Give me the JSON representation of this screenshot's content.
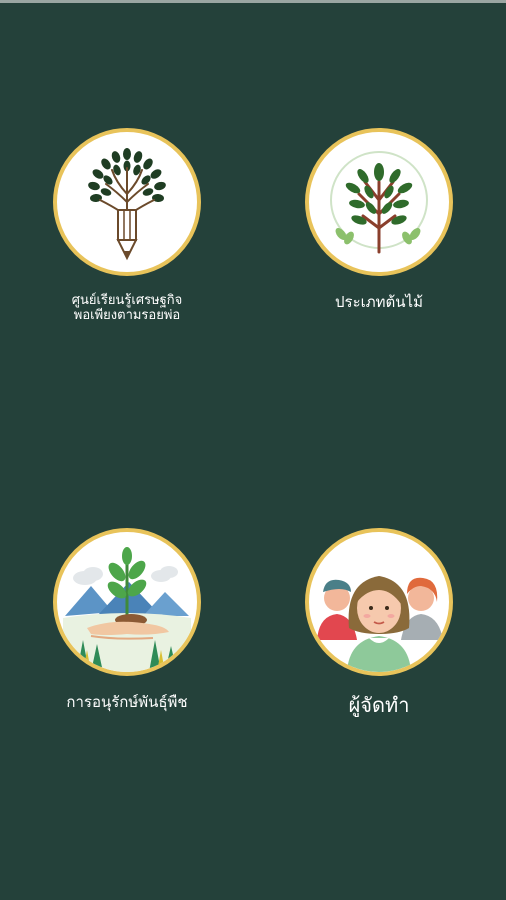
{
  "menu": {
    "items": [
      {
        "label": "ศูนย์เรียนรู้เศรษฐกิจ\nพอเพียงตามรอยพ่อ",
        "icon": "pencil-tree-icon"
      },
      {
        "label": "ประเภทต้นไม้",
        "icon": "tree-icon"
      },
      {
        "label": "การอนุรักษ์พันธุ์พืช",
        "icon": "hand-seedling-icon"
      },
      {
        "label": "ผู้จัดทำ",
        "icon": "people-icon"
      }
    ]
  },
  "colors": {
    "background": "#24413a",
    "circle_border": "#e8c35a",
    "label": "#ffffff"
  }
}
